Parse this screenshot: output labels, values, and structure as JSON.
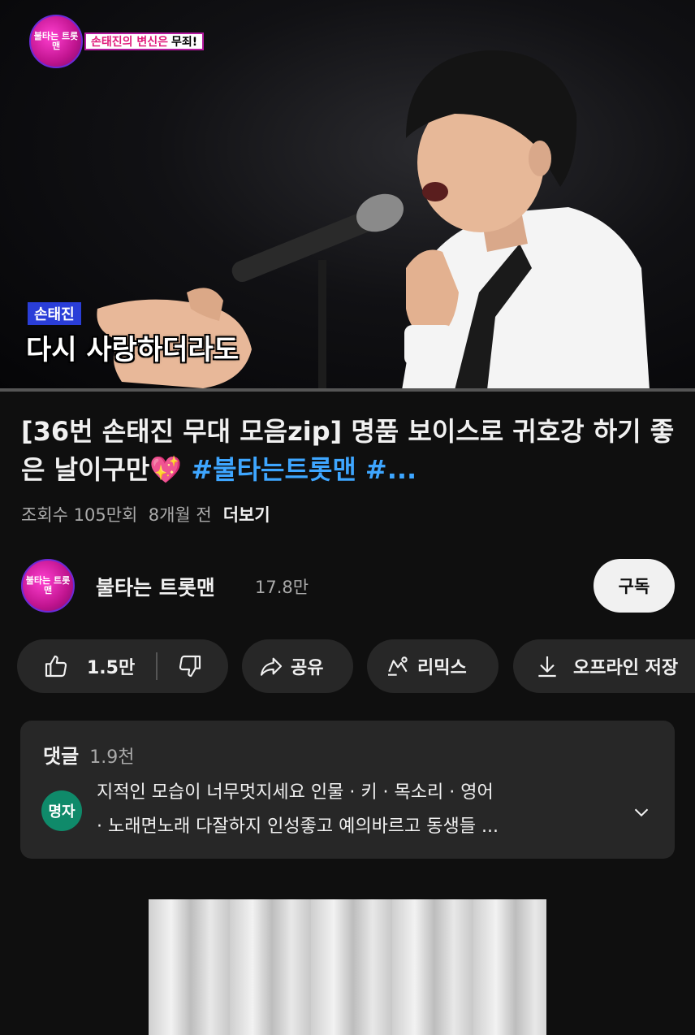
{
  "video": {
    "overlay_logo": "불타는 트롯맨",
    "episode_tag_pink": "손태진의 변신은",
    "episode_tag_dark": "무죄!",
    "caption_name": "손태진",
    "caption_lyric": "다시 사랑하더라도",
    "progress_fraction": 0.0
  },
  "title": {
    "main": "[36번 손태진 무대 모음zip] 명품 보이스로 귀호강 하기 좋은 날이구만💖 ",
    "hashtags": "#불타는트롯맨 #..."
  },
  "meta": {
    "views": "조회수 105만회",
    "age": "8개월 전",
    "more": "더보기"
  },
  "channel": {
    "avatar_text": "불타는 트롯맨",
    "name": "불타는 트롯맨",
    "subscribers": "17.8만",
    "subscribe_label": "구독"
  },
  "actions": {
    "like_count": "1.5만",
    "share_label": "공유",
    "remix_label": "리믹스",
    "download_label": "오프라인 저장"
  },
  "comments": {
    "label": "댓글",
    "count": "1.9천",
    "top_comment": {
      "avatar_text": "명자",
      "avatar_color": "#0f8a6a",
      "line1": "지적인 모습이 너무멋지세요  인물  · 키  · 목소리  · 영어",
      "line2": " · 노래면노래  다잘하지  인성좋고  예의바르고  동생들 ..."
    }
  },
  "colors": {
    "background": "#0f0f0f",
    "pill": "#272727",
    "hashtag": "#3ea6ff",
    "subtle_text": "#aaaaaa"
  },
  "icons": [
    "thumbs-up-icon",
    "thumbs-down-icon",
    "share-icon",
    "remix-icon",
    "download-icon",
    "chevron-down-icon"
  ]
}
